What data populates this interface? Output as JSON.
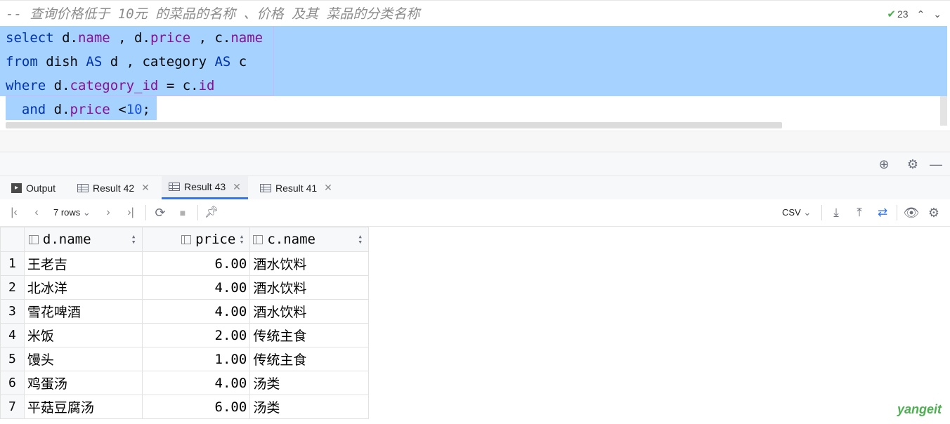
{
  "editor": {
    "comment": "-- 查询价格低于 10元 的菜品的名称 、价格 及其 菜品的分类名称",
    "line1": {
      "kw_select": "select",
      "a": " d.",
      "f1": "name",
      "b": " , d.",
      "f2": "price",
      "c": " , c.",
      "f3": "name"
    },
    "line2": {
      "kw_from": "from",
      "a": " dish ",
      "kw_as1": "AS",
      "b": " d , category ",
      "kw_as2": "AS",
      "c": " c"
    },
    "line3": {
      "kw_where": "where",
      "a": " d.",
      "f1": "category_id",
      "b": " = c.",
      "f2": "id"
    },
    "line4": {
      "indent": "  ",
      "kw_and": "and",
      "a": " d.",
      "f1": "price",
      "b": " <",
      "n": "10",
      "c": ";"
    },
    "inspection_count": "23"
  },
  "tabs": [
    {
      "label": "Output"
    },
    {
      "label": "Result 42"
    },
    {
      "label": "Result 43"
    },
    {
      "label": "Result 41"
    }
  ],
  "toolbar": {
    "rows_label": "7 rows",
    "export_format": "CSV"
  },
  "grid": {
    "columns": [
      "d.name",
      "price",
      "c.name"
    ],
    "rows": [
      {
        "n": "1",
        "name": "王老吉",
        "price": "6.00",
        "cat": "酒水饮料"
      },
      {
        "n": "2",
        "name": "北冰洋",
        "price": "4.00",
        "cat": "酒水饮料"
      },
      {
        "n": "3",
        "name": "雪花啤酒",
        "price": "4.00",
        "cat": "酒水饮料"
      },
      {
        "n": "4",
        "name": "米饭",
        "price": "2.00",
        "cat": "传统主食"
      },
      {
        "n": "5",
        "name": "馒头",
        "price": "1.00",
        "cat": "传统主食"
      },
      {
        "n": "6",
        "name": "鸡蛋汤",
        "price": "4.00",
        "cat": "汤类"
      },
      {
        "n": "7",
        "name": "平菇豆腐汤",
        "price": "6.00",
        "cat": "汤类"
      }
    ]
  },
  "watermark": "yangeit",
  "colors": {
    "selection": "#a6d2ff",
    "keyword": "#0033b3",
    "field": "#871094",
    "number": "#1750eb",
    "accent": "#3574f0"
  }
}
